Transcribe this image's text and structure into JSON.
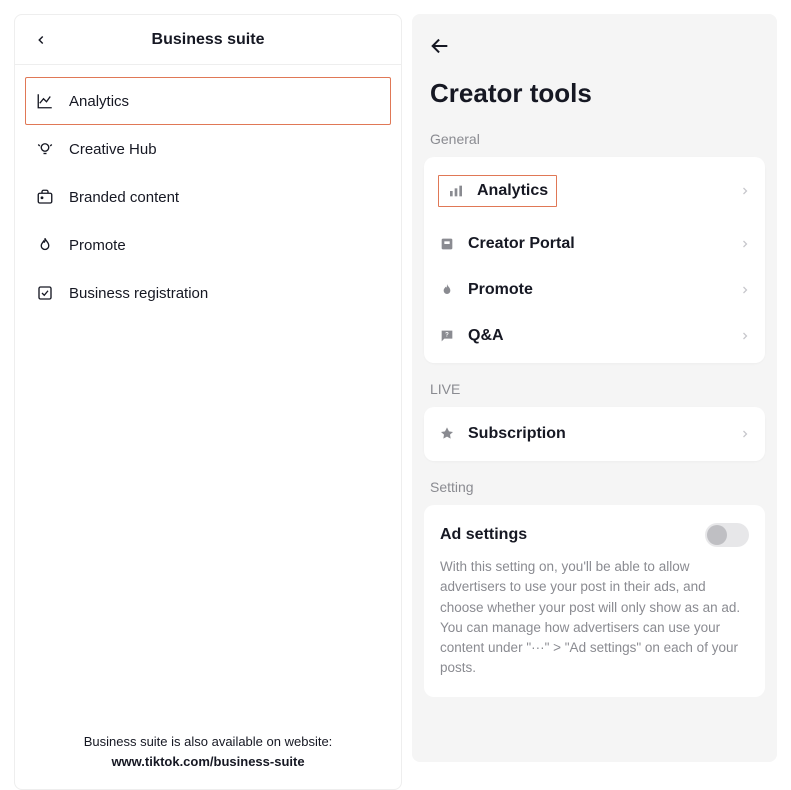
{
  "left": {
    "title": "Business suite",
    "menu": [
      {
        "label": "Analytics",
        "highlighted": true
      },
      {
        "label": "Creative Hub",
        "highlighted": false
      },
      {
        "label": "Branded content",
        "highlighted": false
      },
      {
        "label": "Promote",
        "highlighted": false
      },
      {
        "label": "Business registration",
        "highlighted": false
      }
    ],
    "footer_prefix": "Business suite is also available on website: ",
    "footer_bold": "www.tiktok.com/business-suite"
  },
  "right": {
    "title": "Creator tools",
    "sections": {
      "general_label": "General",
      "general_items": [
        {
          "label": "Analytics"
        },
        {
          "label": "Creator Portal"
        },
        {
          "label": "Promote"
        },
        {
          "label": "Q&A"
        }
      ],
      "live_label": "LIVE",
      "live_items": [
        {
          "label": "Subscription"
        }
      ],
      "setting_label": "Setting",
      "ad_settings": {
        "title": "Ad settings",
        "description": "With this setting on, you'll be able to allow advertisers to use your post in their ads, and choose whether your post will only show as an ad. You can manage how advertisers can use your content under \"···\" > \"Ad settings\" on each of your posts."
      }
    }
  }
}
